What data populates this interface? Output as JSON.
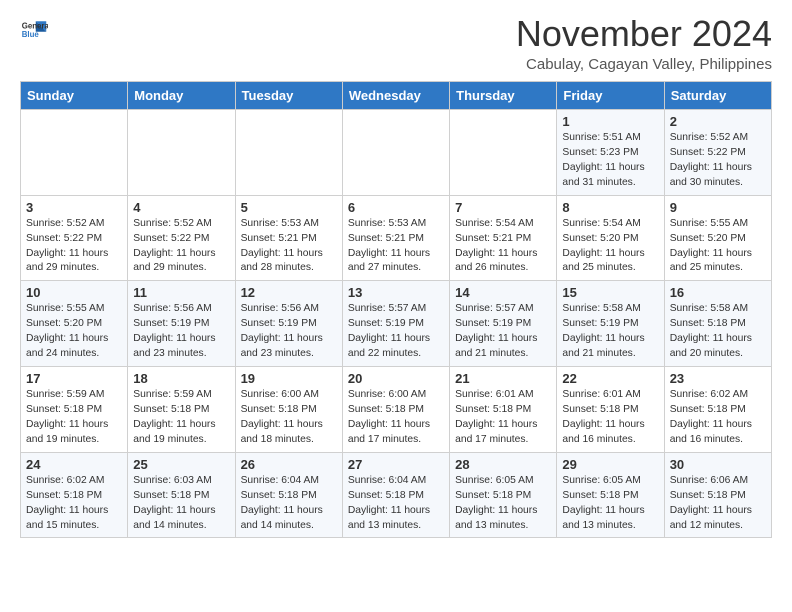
{
  "logo": {
    "line1": "General",
    "line2": "Blue"
  },
  "title": "November 2024",
  "subtitle": "Cabulay, Cagayan Valley, Philippines",
  "weekdays": [
    "Sunday",
    "Monday",
    "Tuesday",
    "Wednesday",
    "Thursday",
    "Friday",
    "Saturday"
  ],
  "weeks": [
    [
      {
        "day": "",
        "info": ""
      },
      {
        "day": "",
        "info": ""
      },
      {
        "day": "",
        "info": ""
      },
      {
        "day": "",
        "info": ""
      },
      {
        "day": "",
        "info": ""
      },
      {
        "day": "1",
        "info": "Sunrise: 5:51 AM\nSunset: 5:23 PM\nDaylight: 11 hours\nand 31 minutes."
      },
      {
        "day": "2",
        "info": "Sunrise: 5:52 AM\nSunset: 5:22 PM\nDaylight: 11 hours\nand 30 minutes."
      }
    ],
    [
      {
        "day": "3",
        "info": "Sunrise: 5:52 AM\nSunset: 5:22 PM\nDaylight: 11 hours\nand 29 minutes."
      },
      {
        "day": "4",
        "info": "Sunrise: 5:52 AM\nSunset: 5:22 PM\nDaylight: 11 hours\nand 29 minutes."
      },
      {
        "day": "5",
        "info": "Sunrise: 5:53 AM\nSunset: 5:21 PM\nDaylight: 11 hours\nand 28 minutes."
      },
      {
        "day": "6",
        "info": "Sunrise: 5:53 AM\nSunset: 5:21 PM\nDaylight: 11 hours\nand 27 minutes."
      },
      {
        "day": "7",
        "info": "Sunrise: 5:54 AM\nSunset: 5:21 PM\nDaylight: 11 hours\nand 26 minutes."
      },
      {
        "day": "8",
        "info": "Sunrise: 5:54 AM\nSunset: 5:20 PM\nDaylight: 11 hours\nand 25 minutes."
      },
      {
        "day": "9",
        "info": "Sunrise: 5:55 AM\nSunset: 5:20 PM\nDaylight: 11 hours\nand 25 minutes."
      }
    ],
    [
      {
        "day": "10",
        "info": "Sunrise: 5:55 AM\nSunset: 5:20 PM\nDaylight: 11 hours\nand 24 minutes."
      },
      {
        "day": "11",
        "info": "Sunrise: 5:56 AM\nSunset: 5:19 PM\nDaylight: 11 hours\nand 23 minutes."
      },
      {
        "day": "12",
        "info": "Sunrise: 5:56 AM\nSunset: 5:19 PM\nDaylight: 11 hours\nand 23 minutes."
      },
      {
        "day": "13",
        "info": "Sunrise: 5:57 AM\nSunset: 5:19 PM\nDaylight: 11 hours\nand 22 minutes."
      },
      {
        "day": "14",
        "info": "Sunrise: 5:57 AM\nSunset: 5:19 PM\nDaylight: 11 hours\nand 21 minutes."
      },
      {
        "day": "15",
        "info": "Sunrise: 5:58 AM\nSunset: 5:19 PM\nDaylight: 11 hours\nand 21 minutes."
      },
      {
        "day": "16",
        "info": "Sunrise: 5:58 AM\nSunset: 5:18 PM\nDaylight: 11 hours\nand 20 minutes."
      }
    ],
    [
      {
        "day": "17",
        "info": "Sunrise: 5:59 AM\nSunset: 5:18 PM\nDaylight: 11 hours\nand 19 minutes."
      },
      {
        "day": "18",
        "info": "Sunrise: 5:59 AM\nSunset: 5:18 PM\nDaylight: 11 hours\nand 19 minutes."
      },
      {
        "day": "19",
        "info": "Sunrise: 6:00 AM\nSunset: 5:18 PM\nDaylight: 11 hours\nand 18 minutes."
      },
      {
        "day": "20",
        "info": "Sunrise: 6:00 AM\nSunset: 5:18 PM\nDaylight: 11 hours\nand 17 minutes."
      },
      {
        "day": "21",
        "info": "Sunrise: 6:01 AM\nSunset: 5:18 PM\nDaylight: 11 hours\nand 17 minutes."
      },
      {
        "day": "22",
        "info": "Sunrise: 6:01 AM\nSunset: 5:18 PM\nDaylight: 11 hours\nand 16 minutes."
      },
      {
        "day": "23",
        "info": "Sunrise: 6:02 AM\nSunset: 5:18 PM\nDaylight: 11 hours\nand 16 minutes."
      }
    ],
    [
      {
        "day": "24",
        "info": "Sunrise: 6:02 AM\nSunset: 5:18 PM\nDaylight: 11 hours\nand 15 minutes."
      },
      {
        "day": "25",
        "info": "Sunrise: 6:03 AM\nSunset: 5:18 PM\nDaylight: 11 hours\nand 14 minutes."
      },
      {
        "day": "26",
        "info": "Sunrise: 6:04 AM\nSunset: 5:18 PM\nDaylight: 11 hours\nand 14 minutes."
      },
      {
        "day": "27",
        "info": "Sunrise: 6:04 AM\nSunset: 5:18 PM\nDaylight: 11 hours\nand 13 minutes."
      },
      {
        "day": "28",
        "info": "Sunrise: 6:05 AM\nSunset: 5:18 PM\nDaylight: 11 hours\nand 13 minutes."
      },
      {
        "day": "29",
        "info": "Sunrise: 6:05 AM\nSunset: 5:18 PM\nDaylight: 11 hours\nand 13 minutes."
      },
      {
        "day": "30",
        "info": "Sunrise: 6:06 AM\nSunset: 5:18 PM\nDaylight: 11 hours\nand 12 minutes."
      }
    ]
  ]
}
